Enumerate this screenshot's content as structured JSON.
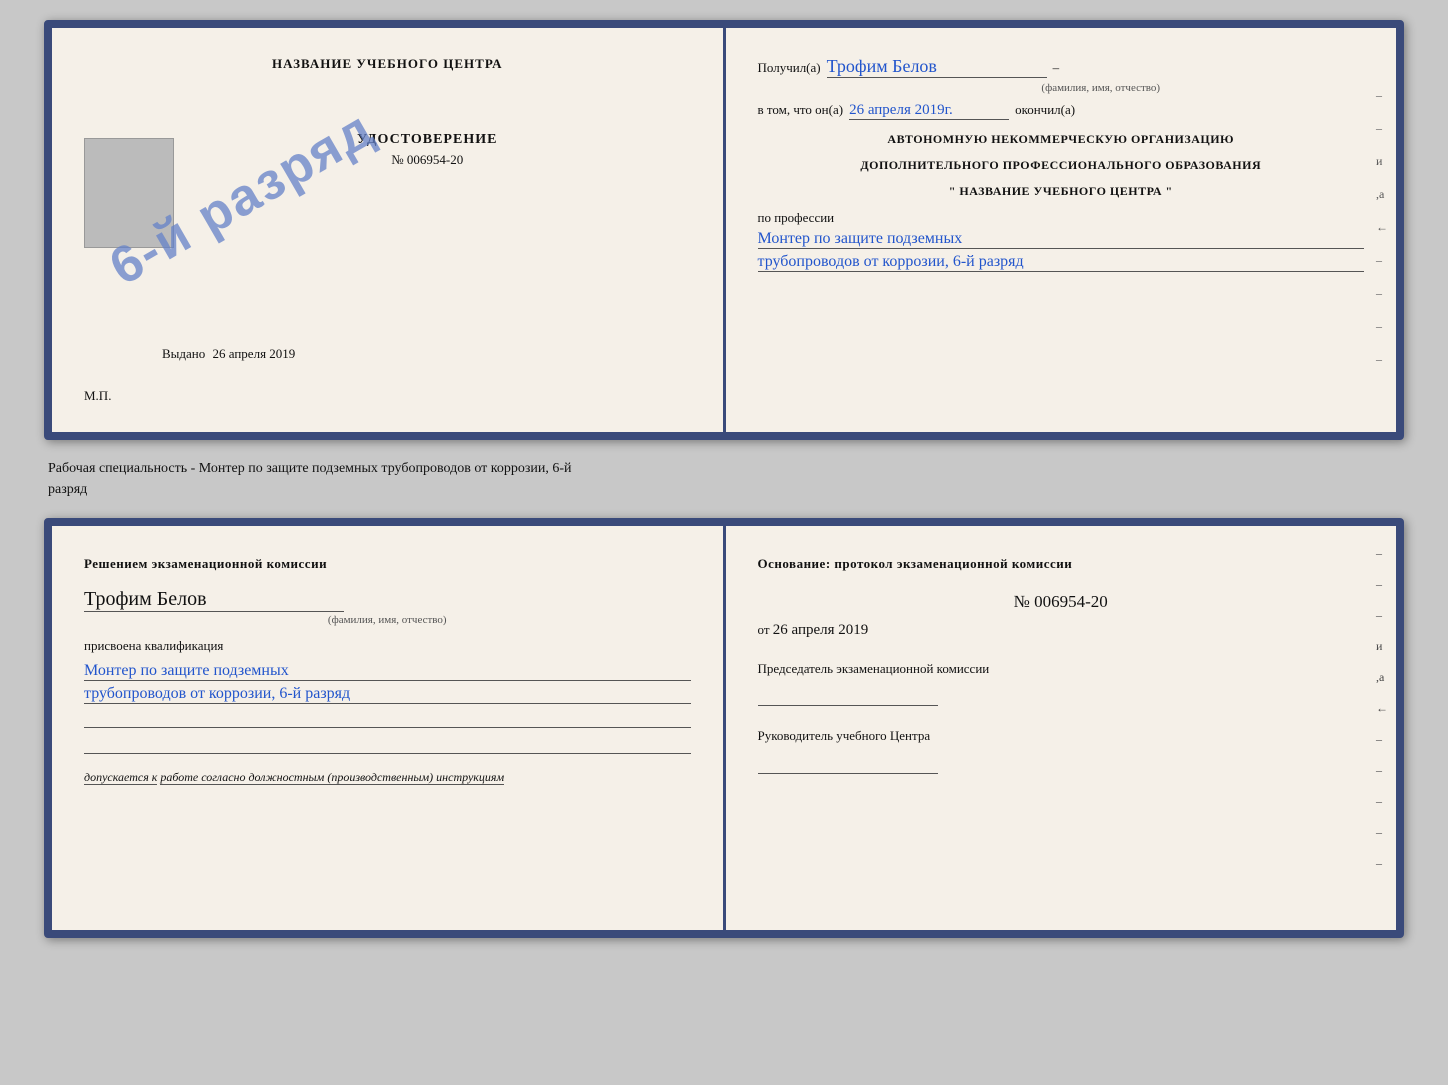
{
  "top_cert": {
    "left": {
      "title": "НАЗВАНИЕ УЧЕБНОГО ЦЕНТРА",
      "stamp_text": "6-й разряд",
      "udost_title": "УДОСТОВЕРЕНИЕ",
      "udost_number": "№ 006954-20",
      "vydano_label": "Выдано",
      "vydano_date": "26 апреля 2019",
      "mp_label": "М.П."
    },
    "right": {
      "poluchil_label": "Получил(a)",
      "recipient_name": "Трофим Белов",
      "fio_sub": "(фамилия, имя, отчество)",
      "dash1": "–",
      "vtom_label": "в том, что он(a)",
      "date_handwritten": "26 апреля 2019г.",
      "okonchil_label": "окончил(a)",
      "org_line1": "АВТОНОМНУЮ НЕКОММЕРЧЕСКУЮ ОРГАНИЗАЦИЮ",
      "org_line2": "ДОПОЛНИТЕЛЬНОГО ПРОФЕССИОНАЛЬНОГО ОБРАЗОВАНИЯ",
      "org_line3": "\"   НАЗВАНИЕ УЧЕБНОГО ЦЕНТРА   \"",
      "po_professii": "по профессии",
      "profession_line1": "Монтер по защите подземных",
      "profession_line2": "трубопроводов от коррозии, 6-й разряд",
      "right_deco": [
        "–",
        "–",
        "и",
        ",а",
        "←",
        "–",
        "–",
        "–",
        "–",
        "–"
      ]
    }
  },
  "middle_text": {
    "line1": "Рабочая специальность - Монтер по защите подземных трубопроводов от коррозии, 6-й",
    "line2": "разряд"
  },
  "lower_cert": {
    "left": {
      "heading": "Решением  экзаменационной  комиссии",
      "name_hw": "Трофим Белов",
      "fio_sub": "(фамилия, имя, отчество)",
      "assigned_label": "присвоена квалификация",
      "qual_line1": "Монтер по защите подземных",
      "qual_line2": "трубопроводов от коррозии, 6-й разряд",
      "допускается_label": "допускается к",
      "допускается_value": "работе согласно должностным (производственным) инструкциям"
    },
    "right": {
      "osnov_label": "Основание: протокол экзаменационной  комиссии",
      "number_hw": "№  006954-20",
      "ot_label": "от",
      "ot_date": "26 апреля 2019",
      "chairman_title": "Председатель экзаменационной комиссии",
      "head_title": "Руководитель учебного Центра",
      "right_deco": [
        "–",
        "–",
        "–",
        "и",
        ",а",
        "←",
        "–",
        "–",
        "–",
        "–",
        "–"
      ]
    }
  }
}
